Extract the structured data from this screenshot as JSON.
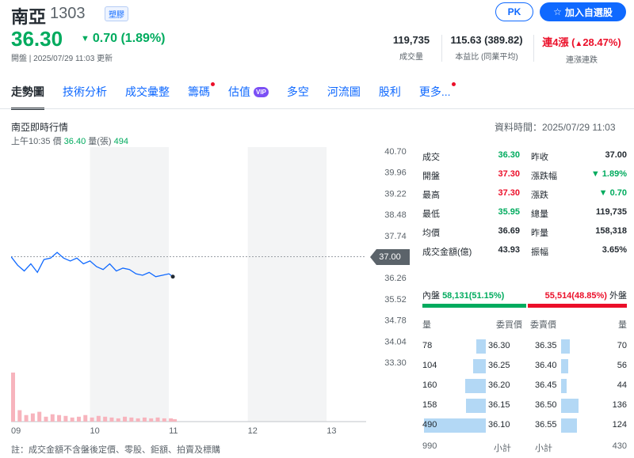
{
  "header": {
    "name": "南亞",
    "code": "1303",
    "category": "塑膠",
    "pk_label": "PK",
    "watch_label": "加入自選股",
    "price": "36.30",
    "change": "0.70 (1.89%)",
    "status": "開盤 | 2025/07/29 11:03 更新",
    "stats": [
      {
        "value": "119,735",
        "label": "成交量"
      },
      {
        "value": "115.63 (389.82)",
        "label": "本益比 (同業平均)"
      },
      {
        "value_prefix": "連4漲",
        "value": "28.47%",
        "label": "連漲連跌"
      }
    ]
  },
  "nav": [
    "走勢圖",
    "技術分析",
    "成交彙整",
    "籌碼",
    "估值",
    "多空",
    "河流圖",
    "股利",
    "更多..."
  ],
  "nav_vip": "VIP",
  "section": {
    "title": "南亞即時行情",
    "time": "資料時間：2025/07/29 11:03",
    "quote_time": "上午10:35",
    "quote_price_label": "價",
    "quote_price": "36.40",
    "quote_vol_label": "量(張)",
    "quote_vol": "494"
  },
  "chart_data": {
    "type": "line",
    "y_ticks": [
      "40.70",
      "39.96",
      "39.22",
      "38.48",
      "37.74",
      "37.00",
      "36.26",
      "35.52",
      "34.78",
      "34.04",
      "33.30"
    ],
    "x_ticks": [
      "09",
      "10",
      "11",
      "12",
      "13"
    ],
    "ylim": [
      33.3,
      40.7
    ],
    "reference": 37.0,
    "reference_label": "37.00",
    "x": [
      "09:00",
      "09:05",
      "09:10",
      "09:15",
      "09:20",
      "09:25",
      "09:30",
      "09:35",
      "09:40",
      "09:45",
      "09:50",
      "09:55",
      "10:00",
      "10:05",
      "10:10",
      "10:15",
      "10:20",
      "10:25",
      "10:30",
      "10:35",
      "10:40",
      "10:45",
      "10:50",
      "10:55",
      "11:00",
      "11:03"
    ],
    "values": [
      37.0,
      36.7,
      36.5,
      36.75,
      36.45,
      36.9,
      36.95,
      37.15,
      36.95,
      36.85,
      36.95,
      36.75,
      36.85,
      36.65,
      36.55,
      36.75,
      36.5,
      36.6,
      36.55,
      36.4,
      36.35,
      36.45,
      36.3,
      36.35,
      36.4,
      36.3
    ],
    "volume": [
      60,
      14,
      8,
      10,
      12,
      6,
      9,
      8,
      7,
      5,
      6,
      8,
      5,
      7,
      6,
      5,
      4,
      6,
      5,
      4,
      5,
      4,
      5,
      4,
      4,
      3
    ]
  },
  "quote_table": [
    [
      {
        "label": "成交",
        "value": "36.30",
        "color": "g"
      },
      {
        "label": "昨收",
        "value": "37.00",
        "color": ""
      }
    ],
    [
      {
        "label": "開盤",
        "value": "37.30",
        "color": "r"
      },
      {
        "label": "漲跌幅",
        "value": "1.89%",
        "color": "g",
        "arrow": true
      }
    ],
    [
      {
        "label": "最高",
        "value": "37.30",
        "color": "r"
      },
      {
        "label": "漲跌",
        "value": "0.70",
        "color": "g",
        "arrow": true
      }
    ],
    [
      {
        "label": "最低",
        "value": "35.95",
        "color": "g"
      },
      {
        "label": "總量",
        "value": "119,735",
        "color": ""
      }
    ],
    [
      {
        "label": "均價",
        "value": "36.69",
        "color": ""
      },
      {
        "label": "昨量",
        "value": "158,318",
        "color": ""
      }
    ],
    [
      {
        "label": "成交金額(億)",
        "value": "43.93",
        "color": ""
      },
      {
        "label": "振幅",
        "value": "3.65%",
        "color": ""
      }
    ]
  ],
  "pressure": {
    "in_label": "內盤",
    "in_value": "58,131(51.15%)",
    "out_value": "55,514(48.85%)",
    "out_label": "外盤",
    "in_pct": 51.15,
    "out_pct": 48.85
  },
  "book": {
    "headers": [
      "量",
      "委買價",
      "委賣價",
      "量"
    ],
    "rows": [
      {
        "bq": "78",
        "bp": "36.30",
        "ap": "36.35",
        "aq": "70",
        "bw": 16,
        "aw": 14
      },
      {
        "bq": "104",
        "bp": "36.25",
        "ap": "36.40",
        "aq": "56",
        "bw": 21,
        "aw": 11
      },
      {
        "bq": "160",
        "bp": "36.20",
        "ap": "36.45",
        "aq": "44",
        "bw": 33,
        "aw": 9
      },
      {
        "bq": "158",
        "bp": "36.15",
        "ap": "36.50",
        "aq": "136",
        "bw": 32,
        "aw": 28
      },
      {
        "bq": "490",
        "bp": "36.10",
        "ap": "36.55",
        "aq": "124",
        "bw": 100,
        "aw": 25
      }
    ],
    "bid_total": "990",
    "bid_total_label": "小計",
    "ask_total_label": "小計",
    "ask_total": "430"
  },
  "note": "註：成交金額不含盤後定價、零股、鉅額、拍賣及標購",
  "colors": {
    "up": "#eb0f29",
    "down": "#00ab5e",
    "accent": "#0f69ff"
  }
}
